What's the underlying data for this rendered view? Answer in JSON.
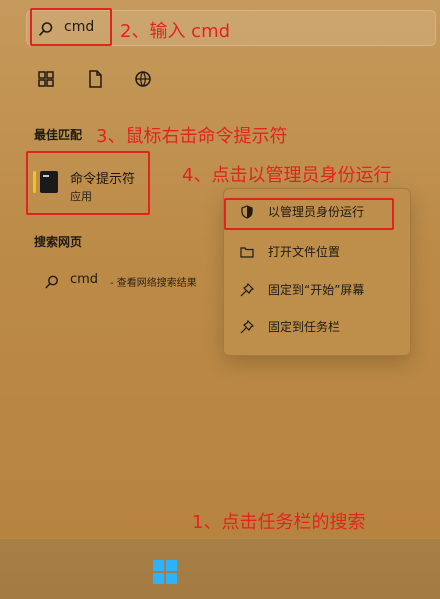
{
  "search": {
    "value": "cmd"
  },
  "annotations": {
    "step1": "1、点击任务栏的搜索",
    "step2": "2、输入 cmd",
    "step3": "3、鼠标右击命令提示符",
    "step4": "4、点击以管理员身份运行"
  },
  "quick_actions": [
    {
      "name": "apps-icon"
    },
    {
      "name": "document-icon"
    },
    {
      "name": "web-icon"
    }
  ],
  "best_match": {
    "title": "最佳匹配",
    "app": {
      "name": "命令提示符",
      "type": "应用"
    }
  },
  "web_search": {
    "title": "搜索网页",
    "query": "cmd",
    "suffix": " - 查看网络搜索结果"
  },
  "context_menu": {
    "items": [
      {
        "label": "以管理员身份运行",
        "icon": "shield-icon"
      },
      {
        "label": "打开文件位置",
        "icon": "folder-icon"
      },
      {
        "label": "固定到“开始”屏幕",
        "icon": "pin-icon"
      },
      {
        "label": "固定到任务栏",
        "icon": "pin-icon"
      }
    ]
  },
  "taskbar": {
    "start_icon": "windows-start-icon"
  },
  "colors": {
    "annotation_red": "#e1241f",
    "panel_bg": "#c28f47",
    "windows_blue": "#2bb3ff",
    "app_accent": "#f0c41d"
  }
}
